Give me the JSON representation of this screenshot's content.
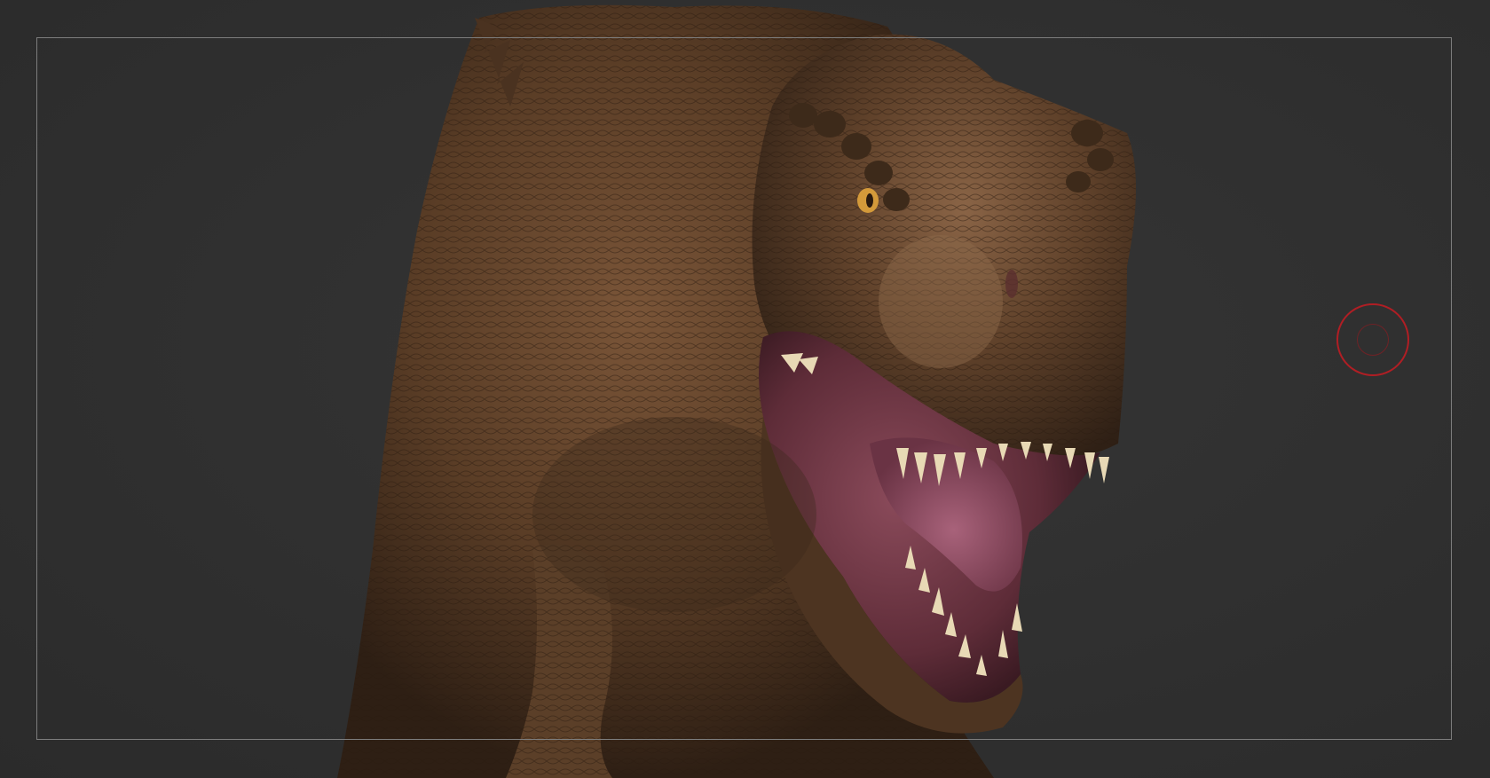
{
  "viewport": {
    "background": "#303030",
    "frame_guide_color": "#7d7d7d"
  },
  "model": {
    "subject": "t-rex-sculpt",
    "skin_color": "#5a3d26",
    "skin_highlight": "#8a6446",
    "mouth_color": "#7a3a48",
    "teeth_color": "#e8d9b5",
    "eye_color": "#d49a3a"
  },
  "brush": {
    "icon": "brush-cursor-icon",
    "color": "#b01e24"
  }
}
